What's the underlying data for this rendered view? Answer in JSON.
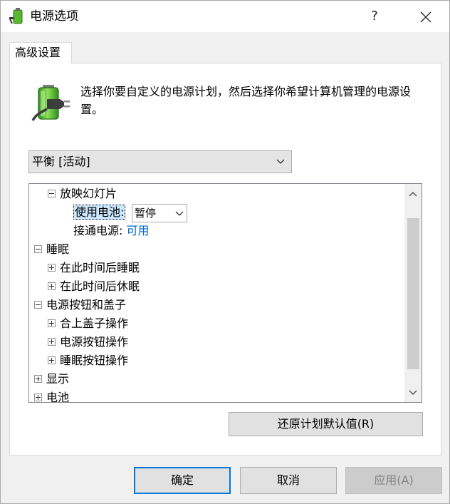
{
  "window": {
    "title": "电源选项",
    "help_label": "?",
    "close_icon": "close-icon"
  },
  "tabs": [
    {
      "label": "高级设置",
      "active": true
    }
  ],
  "header": {
    "description": "选择你要自定义的电源计划，然后选择你希望计算机管理的电源设置。"
  },
  "plan_select": {
    "selected": "平衡 [活动]"
  },
  "tree": {
    "slideshow": {
      "label": "放映幻灯片",
      "on_battery_label": "使用电池:",
      "on_battery_value": "暂停",
      "plugged_in_label": "接通电源:",
      "plugged_in_value": "可用"
    },
    "sleep": {
      "label": "睡眠",
      "children": [
        "在此时间后睡眠",
        "在此时间后休眠"
      ]
    },
    "power_buttons": {
      "label": "电源按钮和盖子",
      "children": [
        "合上盖子操作",
        "电源按钮操作",
        "睡眠按钮操作"
      ]
    },
    "display": {
      "label": "显示"
    },
    "battery": {
      "label": "电池"
    }
  },
  "buttons": {
    "restore_defaults": "还原计划默认值(R)",
    "ok": "确定",
    "cancel": "取消",
    "apply": "应用(A)"
  },
  "colors": {
    "accent": "#0078d7",
    "link": "#0066cc",
    "selection": "#cce8ff"
  }
}
